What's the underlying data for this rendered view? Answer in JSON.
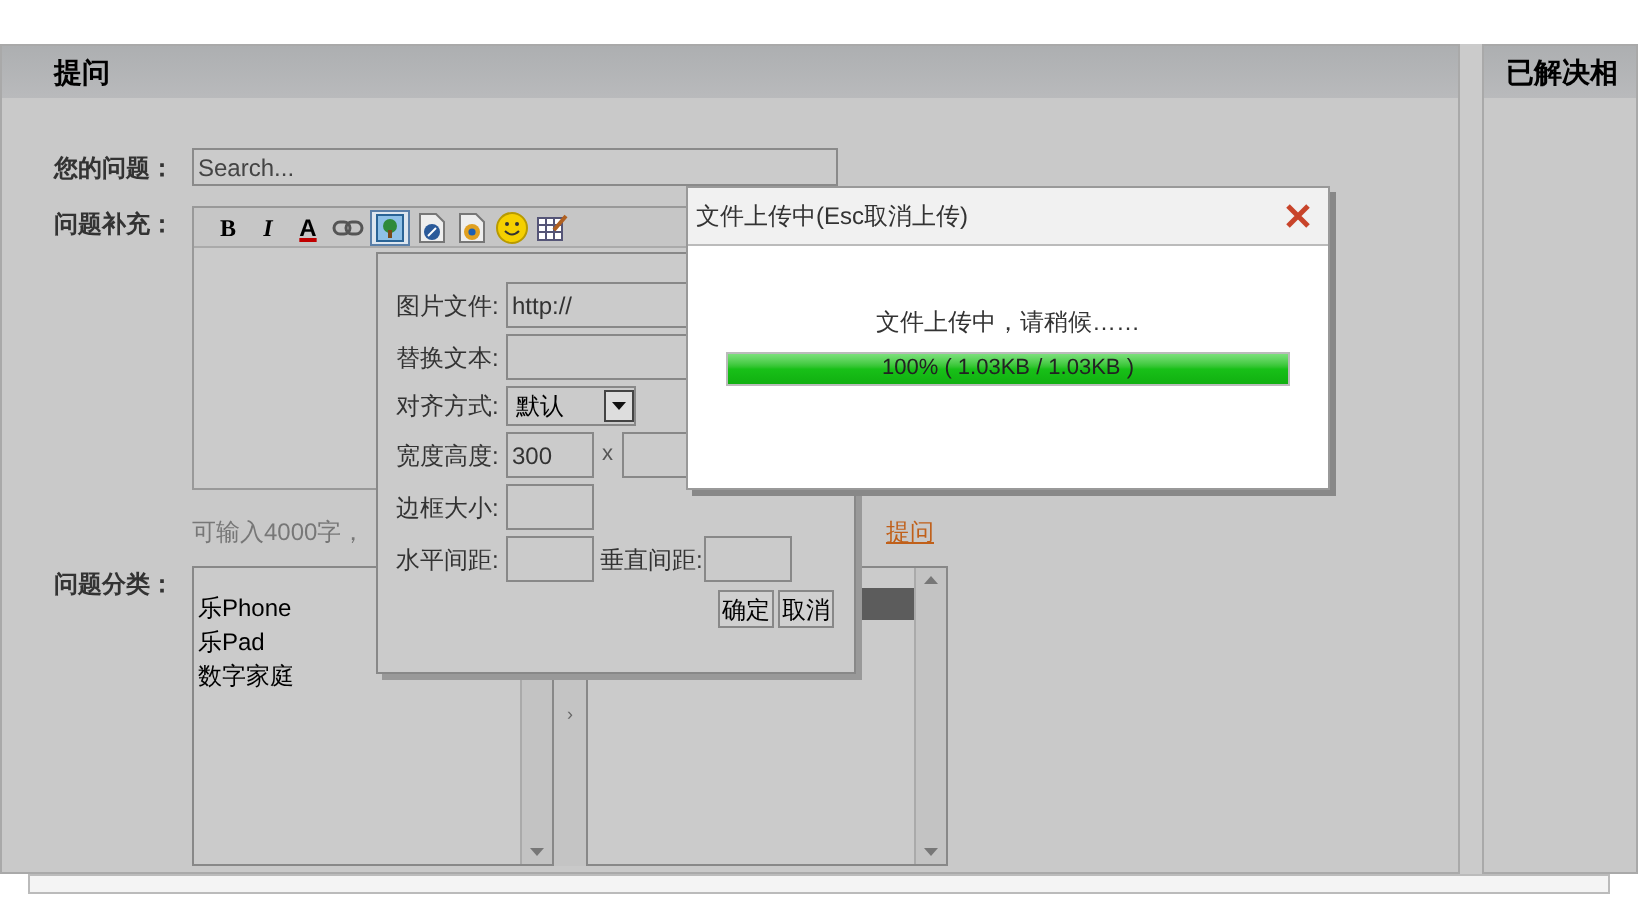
{
  "panel": {
    "title": "提问"
  },
  "question": {
    "label": "您的问题：",
    "placeholder": "Search..."
  },
  "details": {
    "label": "问题补充：",
    "toolbar": [
      {
        "kind": "bold",
        "label": "B",
        "selected": false
      },
      {
        "kind": "italic",
        "label": "I",
        "selected": false
      },
      {
        "kind": "color",
        "label": "A",
        "selected": false
      },
      {
        "kind": "link",
        "selected": false
      },
      {
        "kind": "image",
        "selected": true
      },
      {
        "kind": "flash",
        "selected": false
      },
      {
        "kind": "media",
        "selected": false
      },
      {
        "kind": "emoji",
        "selected": false
      },
      {
        "kind": "table",
        "selected": false
      }
    ],
    "hint": "可输入4000字，",
    "link": "提问"
  },
  "category": {
    "label": "问题分类：",
    "items": [
      {
        "label": "乐Phone"
      },
      {
        "label": "乐Pad"
      },
      {
        "label": "数字家庭"
      }
    ],
    "arrow": "›"
  },
  "side_panel": {
    "title": "已解决相"
  },
  "image_dialog": {
    "fields": [
      {
        "kind": "text",
        "label": "图片文件:",
        "value": "http://"
      },
      {
        "kind": "text",
        "label": "替换文本:"
      },
      {
        "kind": "select",
        "label": "对齐方式:",
        "value": "默认"
      },
      {
        "kind": "pair",
        "label": "宽度高度:",
        "value": "300",
        "separator": "x"
      },
      {
        "kind": "small",
        "label": "边框大小:"
      },
      {
        "kind": "double",
        "label": "水平间距:",
        "second_label": "垂直间距:"
      }
    ],
    "buttons": [
      "确定",
      "取消"
    ]
  },
  "upload_dialog": {
    "title": "文件上传中(Esc取消上传)",
    "message": "文件上传中，请稍候……",
    "progress": {
      "level": 1,
      "text": "100% ( 1.03KB / 1.03KB )"
    }
  }
}
